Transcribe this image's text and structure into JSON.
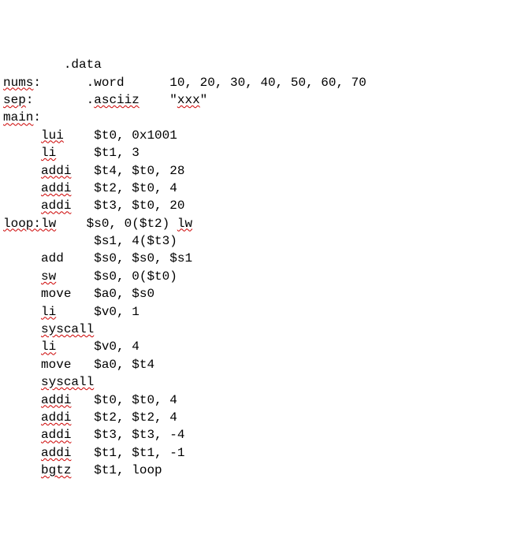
{
  "lines": [
    {
      "indent": 8,
      "parts": [
        {
          "t": ".data",
          "sq": false
        }
      ]
    },
    {
      "indent": 0,
      "parts": [
        {
          "t": "nums",
          "sq": true
        },
        {
          "t": ":      .word      10, 20, 30, 40, 50, 60, 70",
          "sq": false
        }
      ]
    },
    {
      "indent": 0,
      "parts": [
        {
          "t": "sep",
          "sq": true
        },
        {
          "t": ":       .",
          "sq": false
        },
        {
          "t": "asciiz",
          "sq": true
        },
        {
          "t": "    \"",
          "sq": false
        },
        {
          "t": "xxx",
          "sq": true
        },
        {
          "t": "\"",
          "sq": false
        }
      ]
    },
    {
      "indent": 0,
      "parts": [
        {
          "t": "main",
          "sq": true
        },
        {
          "t": ":",
          "sq": false
        }
      ]
    },
    {
      "indent": 5,
      "parts": [
        {
          "t": "lui",
          "sq": true
        },
        {
          "t": "    $t0, 0x1001",
          "sq": false
        }
      ]
    },
    {
      "indent": 5,
      "parts": [
        {
          "t": "li",
          "sq": true
        },
        {
          "t": "     $t1, 3",
          "sq": false
        }
      ]
    },
    {
      "indent": 5,
      "parts": [
        {
          "t": "addi",
          "sq": true
        },
        {
          "t": "   $t4, $t0, 28",
          "sq": false
        }
      ]
    },
    {
      "indent": 5,
      "parts": [
        {
          "t": "addi",
          "sq": true
        },
        {
          "t": "   $t2, $t0, 4",
          "sq": false
        }
      ]
    },
    {
      "indent": 5,
      "parts": [
        {
          "t": "addi",
          "sq": true
        },
        {
          "t": "   $t3, $t0, 20",
          "sq": false
        }
      ]
    },
    {
      "indent": 0,
      "parts": [
        {
          "t": "loop:lw",
          "sq": true
        },
        {
          "t": "    $s0, 0($t2) ",
          "sq": false
        },
        {
          "t": "lw",
          "sq": true
        }
      ]
    },
    {
      "indent": 12,
      "parts": [
        {
          "t": "$s1, 4($t3)",
          "sq": false
        }
      ]
    },
    {
      "indent": 5,
      "parts": [
        {
          "t": "add    $s0, $s0, $s1",
          "sq": false
        }
      ]
    },
    {
      "indent": 5,
      "parts": [
        {
          "t": "sw",
          "sq": true
        },
        {
          "t": "     $s0, 0($t0)",
          "sq": false
        }
      ]
    },
    {
      "indent": 5,
      "parts": [
        {
          "t": "move   $a0, $s0",
          "sq": false
        }
      ]
    },
    {
      "indent": 5,
      "parts": [
        {
          "t": "li",
          "sq": true
        },
        {
          "t": "     $v0, 1",
          "sq": false
        }
      ]
    },
    {
      "indent": 5,
      "parts": [
        {
          "t": "syscall",
          "sq": true
        }
      ]
    },
    {
      "indent": 5,
      "parts": [
        {
          "t": "li",
          "sq": true
        },
        {
          "t": "     $v0, 4",
          "sq": false
        }
      ]
    },
    {
      "indent": 5,
      "parts": [
        {
          "t": "move   $a0, $t4",
          "sq": false
        }
      ]
    },
    {
      "indent": 5,
      "parts": [
        {
          "t": "syscall",
          "sq": true
        }
      ]
    },
    {
      "indent": 5,
      "parts": [
        {
          "t": "addi",
          "sq": true
        },
        {
          "t": "   $t0, $t0, 4",
          "sq": false
        }
      ]
    },
    {
      "indent": 5,
      "parts": [
        {
          "t": "addi",
          "sq": true
        },
        {
          "t": "   $t2, $t2, 4",
          "sq": false
        }
      ]
    },
    {
      "indent": 5,
      "parts": [
        {
          "t": "addi",
          "sq": true
        },
        {
          "t": "   $t3, $t3, -4",
          "sq": false
        }
      ]
    },
    {
      "indent": 5,
      "parts": [
        {
          "t": "addi",
          "sq": true
        },
        {
          "t": "   $t1, $t1, -1",
          "sq": false
        }
      ]
    },
    {
      "indent": 5,
      "parts": [
        {
          "t": "bgtz",
          "sq": true
        },
        {
          "t": "   $t1, loop",
          "sq": false
        }
      ]
    }
  ]
}
